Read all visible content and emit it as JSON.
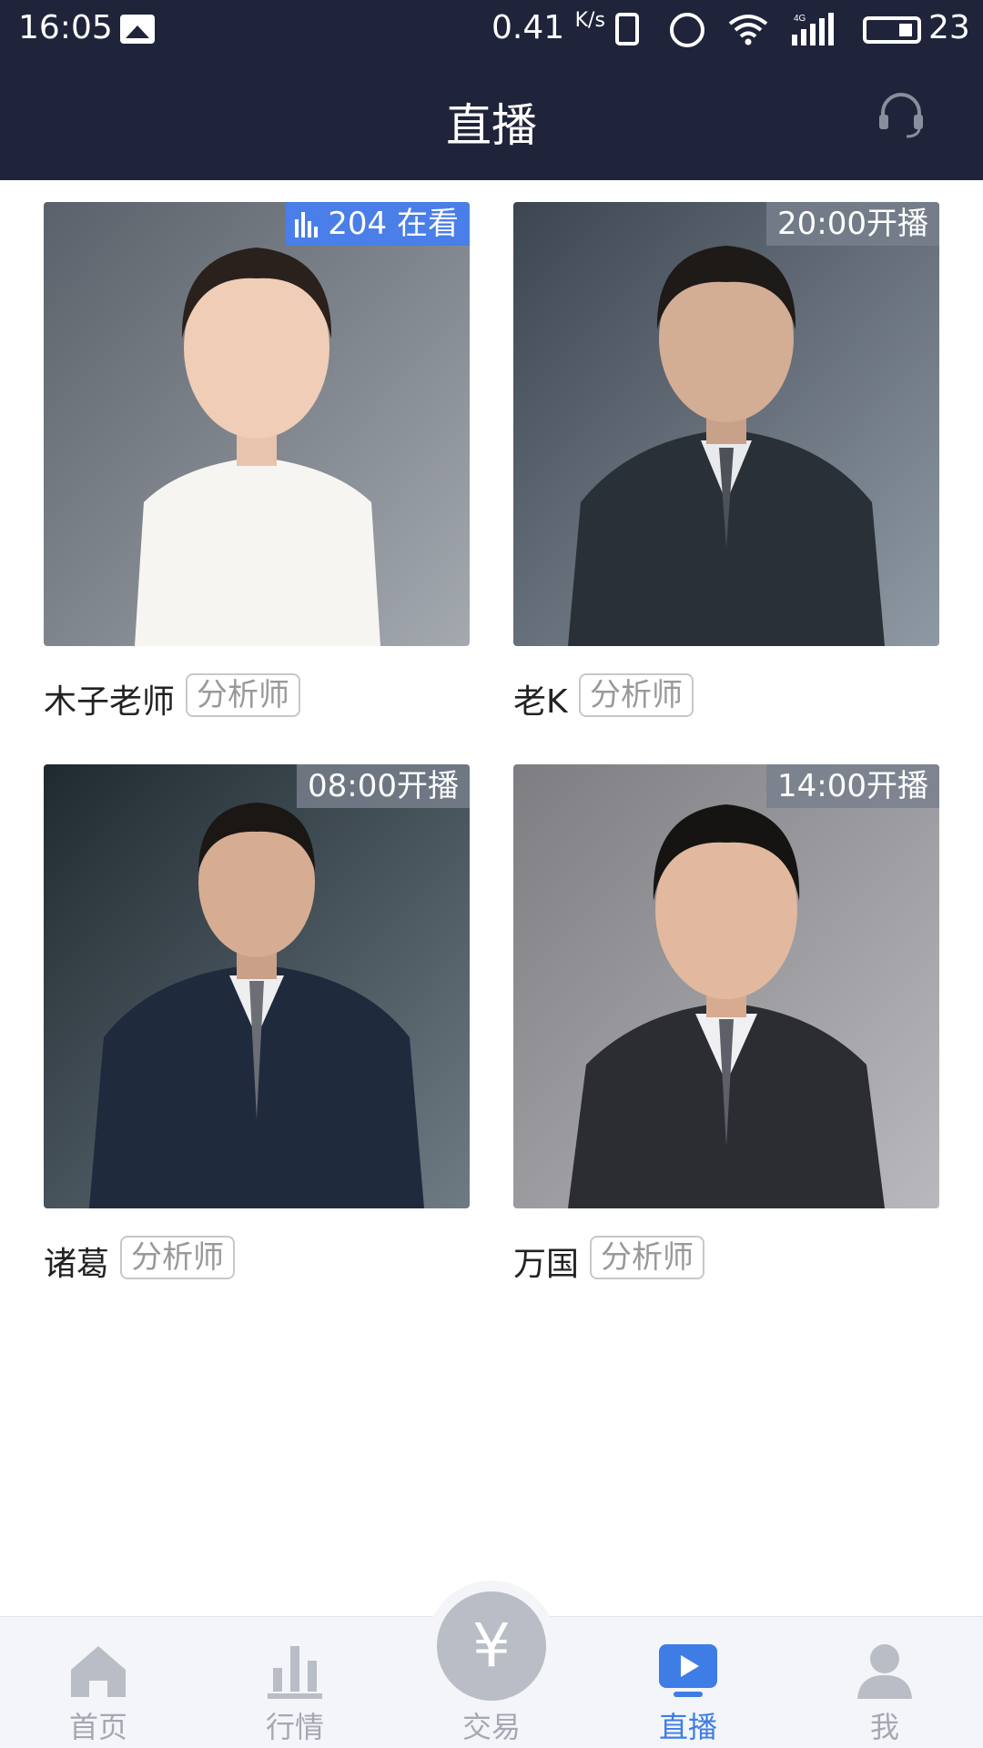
{
  "status_bar": {
    "time": "16:05",
    "net_speed": "0.41",
    "net_unit": "K/s",
    "network": "4G",
    "battery": "23"
  },
  "header": {
    "title": "直播",
    "support_icon": "headset-icon"
  },
  "cards": [
    {
      "name": "木子老师",
      "tag": "分析师",
      "badge": "204 在看",
      "live": true
    },
    {
      "name": "老K",
      "tag": "分析师",
      "badge": "20:00开播",
      "live": false
    },
    {
      "name": "诸葛",
      "tag": "分析师",
      "badge": "08:00开播",
      "live": false
    },
    {
      "name": "万国",
      "tag": "分析师",
      "badge": "14:00开播",
      "live": false
    }
  ],
  "bottom_nav": [
    {
      "label": "首页",
      "icon": "home-icon"
    },
    {
      "label": "行情",
      "icon": "market-chart-icon"
    },
    {
      "label": "交易",
      "icon": "yuan-icon",
      "glyph": "¥"
    },
    {
      "label": "直播",
      "icon": "live-play-icon",
      "active": true
    },
    {
      "label": "我",
      "icon": "user-icon"
    }
  ],
  "colors": {
    "header_bg": "#20243a",
    "accent": "#3e7de6",
    "live_badge": "#4a7ee8",
    "name_text": "#222222",
    "tag_text": "#999999",
    "nav_inactive": "#a4a8b2"
  }
}
